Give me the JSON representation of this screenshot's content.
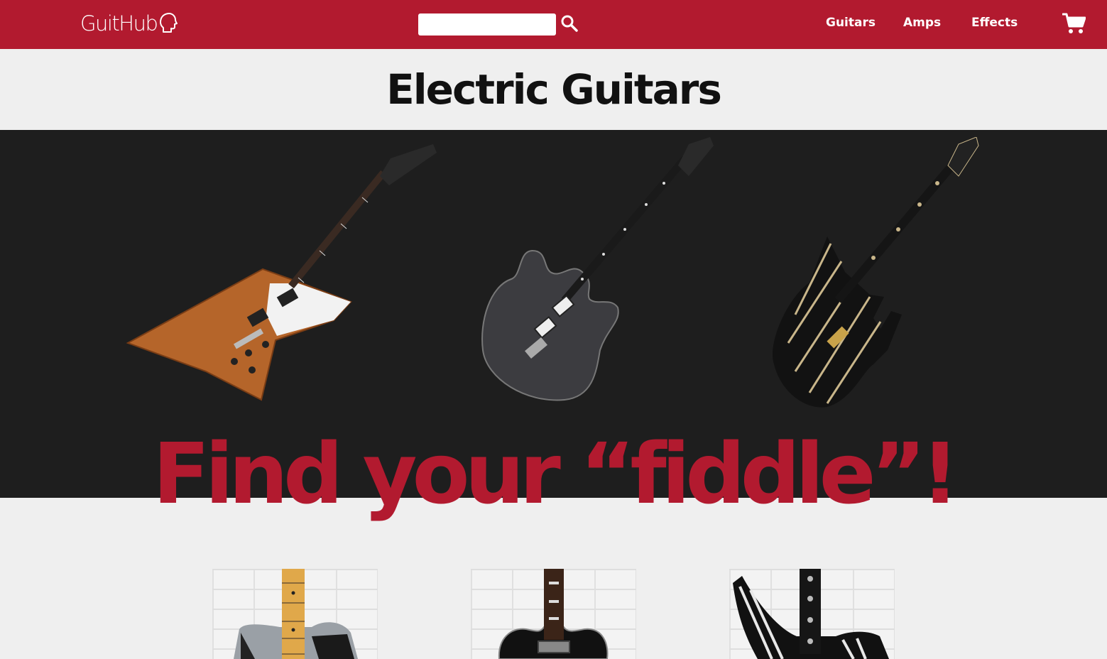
{
  "brand": {
    "name": "GuitHub",
    "logo_icon": "head-silhouette-icon"
  },
  "search": {
    "placeholder": "",
    "value": "",
    "button_icon": "search-icon"
  },
  "nav": {
    "items": [
      {
        "label": "Guitars"
      },
      {
        "label": "Amps"
      },
      {
        "label": "Effects"
      }
    ]
  },
  "cart": {
    "icon": "shopping-cart-icon"
  },
  "page": {
    "title": "Electric Guitars"
  },
  "hero": {
    "tagline": "Find your “fiddle”!"
  },
  "colors": {
    "brand_red": "#b21a2f",
    "hero_bg": "#1e1e1e",
    "page_bg": "#efefef"
  }
}
